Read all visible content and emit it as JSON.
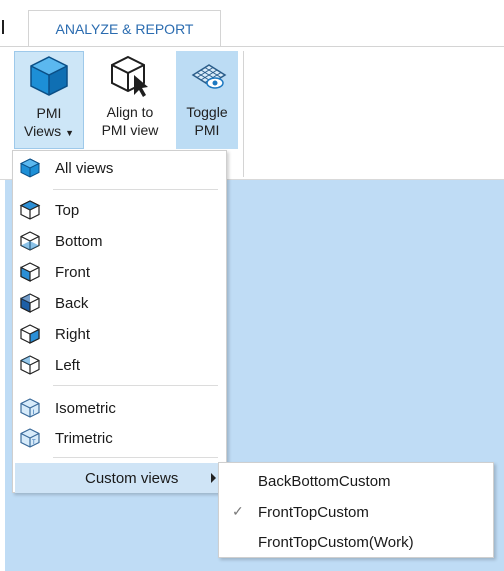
{
  "tabs": {
    "active": "ANALYZE & REPORT"
  },
  "ribbon": {
    "pmi_views": {
      "line1": "PMI",
      "line2": "Views",
      "icon": "blue-cube-icon"
    },
    "align": {
      "line1": "Align to",
      "line2": "PMI view",
      "icon": "cube-cursor-icon"
    },
    "toggle": {
      "line1": "Toggle",
      "line2": "PMI",
      "icon": "pmi-plane-icon"
    }
  },
  "menu": {
    "all_views": "All views",
    "items": [
      "Top",
      "Bottom",
      "Front",
      "Back",
      "Right",
      "Left"
    ],
    "iso": [
      "Isometric",
      "Trimetric"
    ],
    "custom": "Custom views"
  },
  "submenu": {
    "items": [
      "BackBottomCustom",
      "FrontTopCustom",
      "FrontTopCustom(Work)"
    ],
    "checked": "FrontTopCustom"
  },
  "colors": {
    "accent": "#2b6cb0",
    "canvas": "#bfdcf5",
    "menu_highlight": "#cfe4f6",
    "pressed": "#cde6f7"
  }
}
